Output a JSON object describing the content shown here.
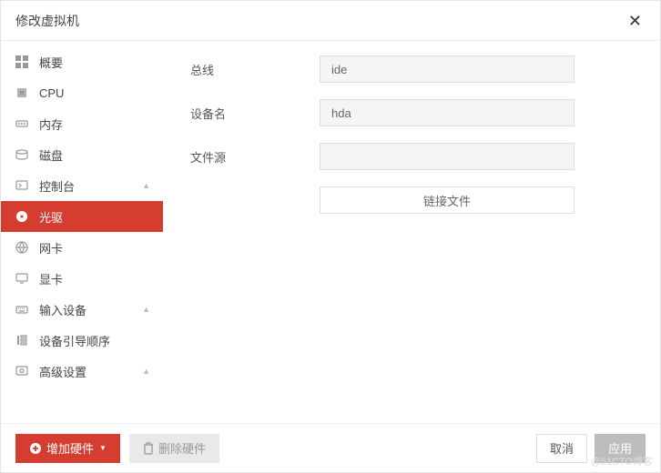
{
  "header": {
    "title": "修改虚拟机"
  },
  "sidebar": {
    "items": [
      {
        "label": "概要",
        "expandable": false
      },
      {
        "label": "CPU",
        "expandable": false
      },
      {
        "label": "内存",
        "expandable": false
      },
      {
        "label": "磁盘",
        "expandable": false
      },
      {
        "label": "控制台",
        "expandable": true
      },
      {
        "label": "光驱",
        "expandable": false
      },
      {
        "label": "网卡",
        "expandable": false
      },
      {
        "label": "显卡",
        "expandable": false
      },
      {
        "label": "输入设备",
        "expandable": true
      },
      {
        "label": "设备引导顺序",
        "expandable": false
      },
      {
        "label": "高级设置",
        "expandable": true
      }
    ]
  },
  "form": {
    "bus": {
      "label": "总线",
      "value": "ide"
    },
    "device": {
      "label": "设备名",
      "value": "hda"
    },
    "source": {
      "label": "文件源",
      "value": ""
    },
    "link_file": "链接文件"
  },
  "footer": {
    "add_hardware": "增加硬件",
    "remove_hardware": "删除硬件",
    "cancel": "取消",
    "apply": "应用"
  },
  "watermark": "@51CTO博客"
}
